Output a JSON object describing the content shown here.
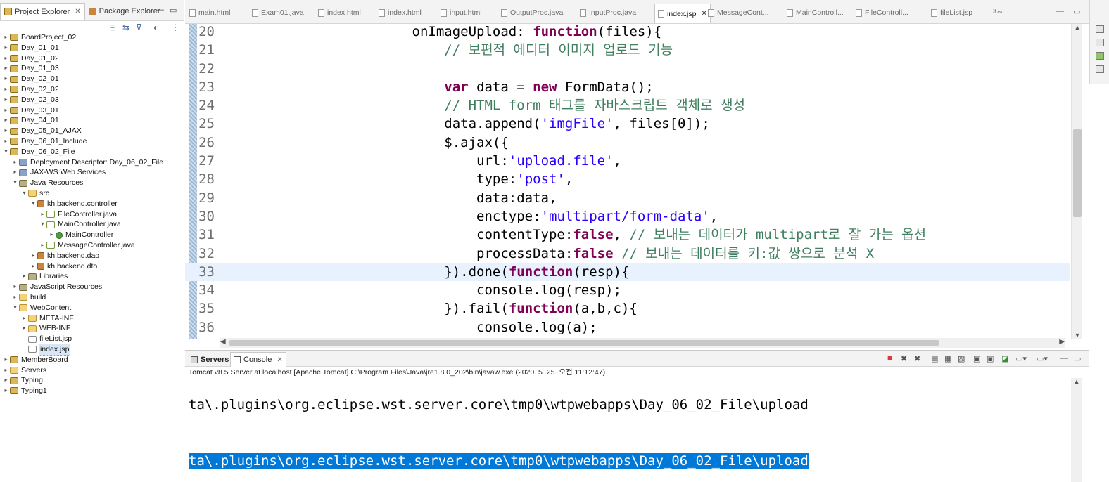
{
  "left_panel": {
    "tabs": [
      {
        "label": "Project Explorer",
        "active": true
      },
      {
        "label": "Package Explorer",
        "active": false
      }
    ],
    "tree": [
      {
        "label": "BoardProject_02",
        "indent": 0,
        "arrow": "›",
        "icon": "project"
      },
      {
        "label": "Day_01_01",
        "indent": 0,
        "arrow": "›",
        "icon": "project"
      },
      {
        "label": "Day_01_02",
        "indent": 0,
        "arrow": "›",
        "icon": "project"
      },
      {
        "label": "Day_01_03",
        "indent": 0,
        "arrow": "›",
        "icon": "project"
      },
      {
        "label": "Day_02_01",
        "indent": 0,
        "arrow": "›",
        "icon": "project"
      },
      {
        "label": "Day_02_02",
        "indent": 0,
        "arrow": "›",
        "icon": "project"
      },
      {
        "label": "Day_02_03",
        "indent": 0,
        "arrow": "›",
        "icon": "project"
      },
      {
        "label": "Day_03_01",
        "indent": 0,
        "arrow": "›",
        "icon": "project"
      },
      {
        "label": "Day_04_01",
        "indent": 0,
        "arrow": "›",
        "icon": "project"
      },
      {
        "label": "Day_05_01_AJAX",
        "indent": 0,
        "arrow": "›",
        "icon": "project"
      },
      {
        "label": "Day_06_01_Include",
        "indent": 0,
        "arrow": "›",
        "icon": "project"
      },
      {
        "label": "Day_06_02_File",
        "indent": 0,
        "arrow": "⌄",
        "icon": "project"
      },
      {
        "label": "Deployment Descriptor: Day_06_02_File",
        "indent": 1,
        "arrow": "›",
        "icon": "desc"
      },
      {
        "label": "JAX-WS Web Services",
        "indent": 1,
        "arrow": "›",
        "icon": "desc"
      },
      {
        "label": "Java Resources",
        "indent": 1,
        "arrow": "⌄",
        "icon": "lib"
      },
      {
        "label": "src",
        "indent": 2,
        "arrow": "⌄",
        "icon": "folder"
      },
      {
        "label": "kh.backend.controller",
        "indent": 3,
        "arrow": "⌄",
        "icon": "package"
      },
      {
        "label": "FileController.java",
        "indent": 4,
        "arrow": "›",
        "icon": "java"
      },
      {
        "label": "MainController.java",
        "indent": 4,
        "arrow": "⌄",
        "icon": "java"
      },
      {
        "label": "MainController",
        "indent": 5,
        "arrow": "›",
        "icon": "class"
      },
      {
        "label": "MessageController.java",
        "indent": 4,
        "arrow": "›",
        "icon": "java"
      },
      {
        "label": "kh.backend.dao",
        "indent": 3,
        "arrow": "›",
        "icon": "package"
      },
      {
        "label": "kh.backend.dto",
        "indent": 3,
        "arrow": "›",
        "icon": "package"
      },
      {
        "label": "Libraries",
        "indent": 2,
        "arrow": "›",
        "icon": "lib"
      },
      {
        "label": "JavaScript Resources",
        "indent": 1,
        "arrow": "›",
        "icon": "lib"
      },
      {
        "label": "build",
        "indent": 1,
        "arrow": "›",
        "icon": "folder"
      },
      {
        "label": "WebContent",
        "indent": 1,
        "arrow": "⌄",
        "icon": "folder"
      },
      {
        "label": "META-INF",
        "indent": 2,
        "arrow": "›",
        "icon": "folder"
      },
      {
        "label": "WEB-INF",
        "indent": 2,
        "arrow": "›",
        "icon": "folder"
      },
      {
        "label": "fileList.jsp",
        "indent": 2,
        "arrow": "",
        "icon": "jsp"
      },
      {
        "label": "index.jsp",
        "indent": 2,
        "arrow": "",
        "icon": "jsp",
        "selected": true
      },
      {
        "label": "MemberBoard",
        "indent": 0,
        "arrow": "›",
        "icon": "project"
      },
      {
        "label": "Servers",
        "indent": 0,
        "arrow": "›",
        "icon": "folder"
      },
      {
        "label": "Typing",
        "indent": 0,
        "arrow": "›",
        "icon": "project"
      },
      {
        "label": "Typing1",
        "indent": 0,
        "arrow": "›",
        "icon": "project"
      }
    ]
  },
  "editor": {
    "tabs": [
      {
        "label": "main.html",
        "active": false
      },
      {
        "label": "Exam01.java",
        "active": false
      },
      {
        "label": "index.html",
        "active": false
      },
      {
        "label": "index.html",
        "active": false
      },
      {
        "label": "input.html",
        "active": false
      },
      {
        "label": "OutputProc.java",
        "active": false
      },
      {
        "label": "InputProc.java",
        "active": false
      },
      {
        "label": "index.jsp",
        "active": true
      },
      {
        "label": "MessageCont...",
        "active": false
      },
      {
        "label": "MainControll...",
        "active": false
      },
      {
        "label": "FileControll...",
        "active": false
      },
      {
        "label": "fileList.jsp",
        "active": false
      }
    ],
    "more_tabs": "»₇₉",
    "lines": [
      {
        "num": "20",
        "html": "                        onImageUpload: <span class=\"kw\">function</span>(files){"
      },
      {
        "num": "21",
        "html": "                            <span class=\"cm\">// 보편적 에디터 이미지 업로드 기능</span>"
      },
      {
        "num": "22",
        "html": ""
      },
      {
        "num": "23",
        "html": "                            <span class=\"kw\">var</span> data = <span class=\"kw\">new</span> FormData();"
      },
      {
        "num": "24",
        "html": "                            <span class=\"cm\">// HTML form 태그를 자바스크립트 객체로 생성</span>"
      },
      {
        "num": "25",
        "html": "                            data.append(<span class=\"str\">'imgFile'</span>, files[0]);"
      },
      {
        "num": "26",
        "html": "                            $.ajax({"
      },
      {
        "num": "27",
        "html": "                                url:<span class=\"str\">'upload.file'</span>,"
      },
      {
        "num": "28",
        "html": "                                type:<span class=\"str\">'post'</span>,"
      },
      {
        "num": "29",
        "html": "                                data:data,"
      },
      {
        "num": "30",
        "html": "                                enctype:<span class=\"str\">'multipart/form-data'</span>,"
      },
      {
        "num": "31",
        "html": "                                contentType:<span class=\"kw\">false</span>, <span class=\"cm\">// 보내는 데이터가 multipart로 잘 가는 옵션</span>"
      },
      {
        "num": "32",
        "html": "                                processData:<span class=\"kw\">false</span> <span class=\"cm\">// 보내는 데이터를 키:값 쌍으로 분석 X</span>"
      },
      {
        "num": "33",
        "html": "                            }).done(<span class=\"kw\">function</span>(resp){",
        "current": true
      },
      {
        "num": "34",
        "html": "                                console.log(resp);"
      },
      {
        "num": "35",
        "html": "                            }).fail(<span class=\"kw\">function</span>(a,b,c){"
      },
      {
        "num": "36",
        "html": "                                console.log(a);"
      }
    ]
  },
  "console": {
    "tabs": [
      {
        "label": "Servers",
        "active": false
      },
      {
        "label": "Console",
        "active": true
      }
    ],
    "process": "Tomcat v8.5 Server at localhost [Apache Tomcat] C:\\Program Files\\Java\\jre1.8.0_202\\bin\\javaw.exe (2020. 5. 25. 오전 11:12:47)",
    "output_line_1": "ta\\.plugins\\org.eclipse.wst.server.core\\tmp0\\wtpwebapps\\Day_06_02_File\\upload",
    "output_line_2": "ta\\.plugins\\org.eclipse.wst.server.core\\tmp0\\wtpwebapps\\Day_06_02_File\\upload"
  },
  "colors": {
    "keyword": "#7f0055",
    "string": "#2a00ff",
    "comment": "#3f7f5f",
    "selection": "#0078d7",
    "current_line": "#e8f2fe"
  }
}
